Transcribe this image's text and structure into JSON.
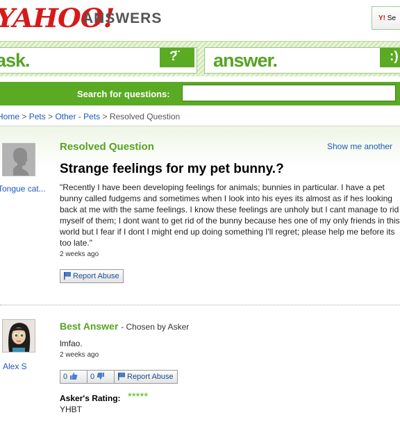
{
  "header": {
    "logo_text": "YAHOO!",
    "logo_tm": "®",
    "brand_text": "ANSWERS",
    "yahoo_button_text": "Se"
  },
  "band": {
    "ask_label": "ask.",
    "answer_label": "answer."
  },
  "search": {
    "label": "Search for questions:",
    "value": "",
    "placeholder": ""
  },
  "breadcrumb": {
    "items": [
      "Home",
      "Pets",
      "Other - Pets",
      "Resolved Question"
    ],
    "separator": ">"
  },
  "question": {
    "status": "Resolved Question",
    "show_another": "Show me another",
    "user": "Tongue cat...",
    "title": "Strange feelings for my pet bunny.?",
    "body": "\"Recently I have been developing feelings for animals; bunnies in particular. I have a pet bunny called fudgems and sometimes when I look into his eyes its almost as if hes looking back at me with the same feelings. I know these feelings are unholy but I cant manage to rid myself of them; I dont want to get rid of the bunny because hes one of my only friends in this world but I fear if I dont I might end up doing something I'll regret; please help me before its too late.\"",
    "time_ago": "2 weeks ago",
    "report_label": "Report Abuse"
  },
  "answer": {
    "heading": "Best Answer",
    "chosen_by": "- Chosen by Asker",
    "user": "Alex S",
    "text": "lmfao.",
    "time_ago": "2 weeks ago",
    "thumbs_up_count": "0",
    "thumbs_down_count": "0",
    "report_label": "Report Abuse",
    "rating_label": "Asker's Rating:",
    "rating_stars": "*****",
    "rating_value": 5,
    "rating_comment": "YHBT"
  },
  "colors": {
    "yahoo_red": "#d61a1a",
    "brand_green": "#5aaa24",
    "link_blue": "#1b59b5"
  }
}
